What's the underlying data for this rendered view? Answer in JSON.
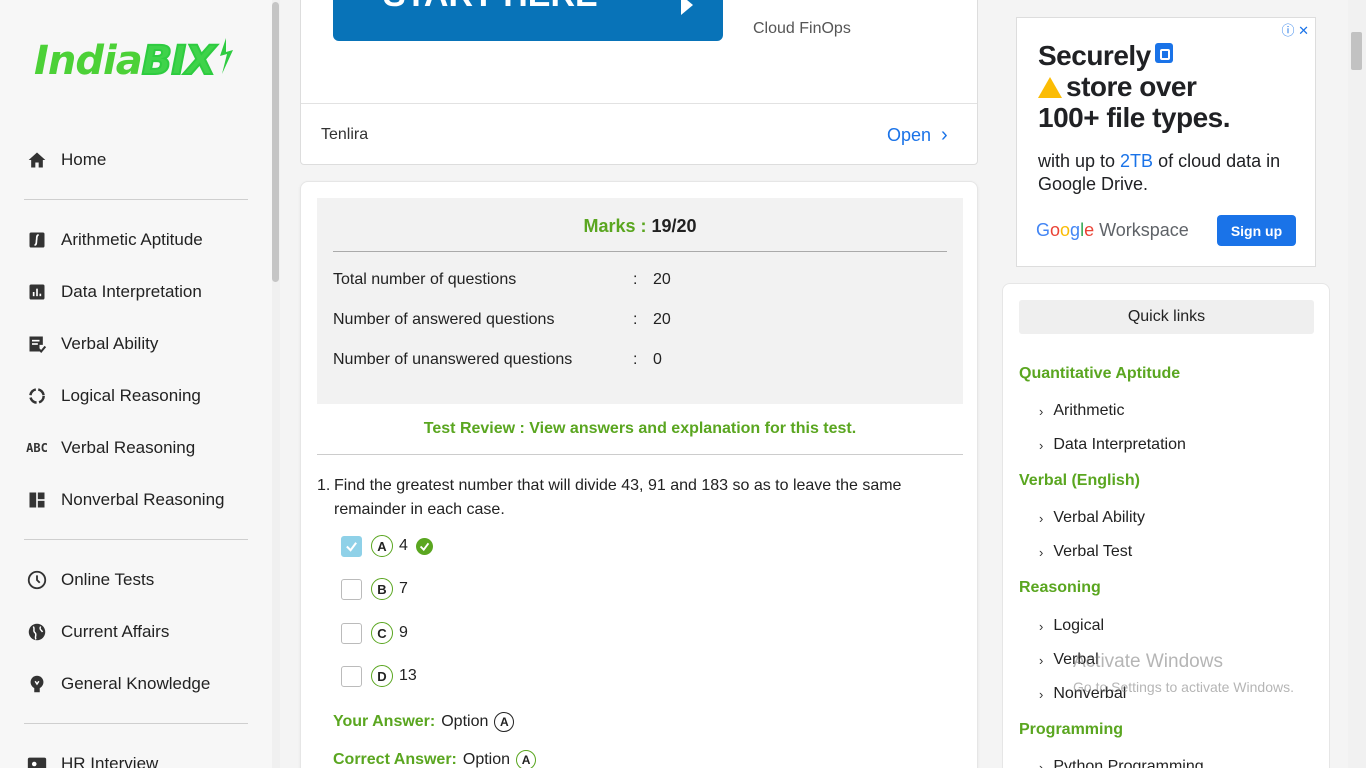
{
  "logo": {
    "text_a": "India",
    "text_b": "BIX"
  },
  "sidebar": {
    "items": [
      {
        "label": "Home",
        "icon": "home-icon"
      },
      {
        "label": "Arithmetic Aptitude",
        "icon": "integral-icon"
      },
      {
        "label": "Data Interpretation",
        "icon": "bar-chart-icon"
      },
      {
        "label": "Verbal Ability",
        "icon": "checklist-icon"
      },
      {
        "label": "Logical Reasoning",
        "icon": "cycle-icon"
      },
      {
        "label": "Verbal Reasoning",
        "icon": "abc-icon"
      },
      {
        "label": "Nonverbal Reasoning",
        "icon": "dashboard-icon"
      },
      {
        "label": "Online Tests",
        "icon": "clock-icon"
      },
      {
        "label": "Current Affairs",
        "icon": "globe-icon"
      },
      {
        "label": "General Knowledge",
        "icon": "bulb-icon"
      },
      {
        "label": "HR Interview",
        "icon": "badge-icon"
      }
    ]
  },
  "ad_top": {
    "button_label": "START HERE",
    "brand": "Cloud FinOps",
    "advertiser": "Tenlira",
    "open_label": "Open"
  },
  "result": {
    "marks_label": "Marks :",
    "marks_value": "19/20",
    "rows": [
      {
        "label": "Total number of questions",
        "sep": ":",
        "value": "20"
      },
      {
        "label": "Number of answered questions",
        "sep": ":",
        "value": "20"
      },
      {
        "label": "Number of unanswered questions",
        "sep": ":",
        "value": "0"
      }
    ],
    "review_link": "Test Review : View answers and explanation for this test."
  },
  "question": {
    "number": "1.",
    "text": "Find the greatest number that will divide 43, 91 and 183 so as to leave the same remainder in each case.",
    "options": [
      {
        "letter": "A",
        "value": "4",
        "checked": true,
        "correct": true
      },
      {
        "letter": "B",
        "value": "7",
        "checked": false,
        "correct": false
      },
      {
        "letter": "C",
        "value": "9",
        "checked": false,
        "correct": false
      },
      {
        "letter": "D",
        "value": "13",
        "checked": false,
        "correct": false
      }
    ],
    "your_answer_label": "Your Answer:",
    "your_answer_text": "Option",
    "your_answer_letter": "A",
    "correct_answer_label": "Correct Answer:",
    "correct_answer_text": "Option",
    "correct_answer_letter": "A"
  },
  "ad_right": {
    "headline_1": "Securely",
    "headline_2": "store over",
    "headline_3": "100+ file types.",
    "body_a": "with up to ",
    "body_hl": "2TB",
    "body_b": " of cloud data in Google Drive.",
    "brand_g": "G",
    "brand_o1": "o",
    "brand_o2": "o",
    "brand_g2": "g",
    "brand_l": "l",
    "brand_e": "e",
    "brand_ws": " Workspace",
    "cta": "Sign up",
    "close": "ⓘ ✕"
  },
  "quick_links": {
    "title": "Quick links",
    "groups": [
      {
        "category": "Quantitative Aptitude",
        "links": [
          "Arithmetic",
          "Data Interpretation"
        ]
      },
      {
        "category": "Verbal (English)",
        "links": [
          "Verbal Ability",
          "Verbal Test"
        ]
      },
      {
        "category": "Reasoning",
        "links": [
          "Logical",
          "Verbal",
          "Nonverbal"
        ]
      },
      {
        "category": "Programming",
        "links": [
          "Python Programming"
        ]
      }
    ]
  },
  "watermark": {
    "line1": "Activate Windows",
    "line2": "Go to Settings to activate Windows."
  },
  "colors": {
    "accent_green": "#5aa620",
    "link_blue": "#1a73e8",
    "ad_blue": "#0873b8"
  }
}
